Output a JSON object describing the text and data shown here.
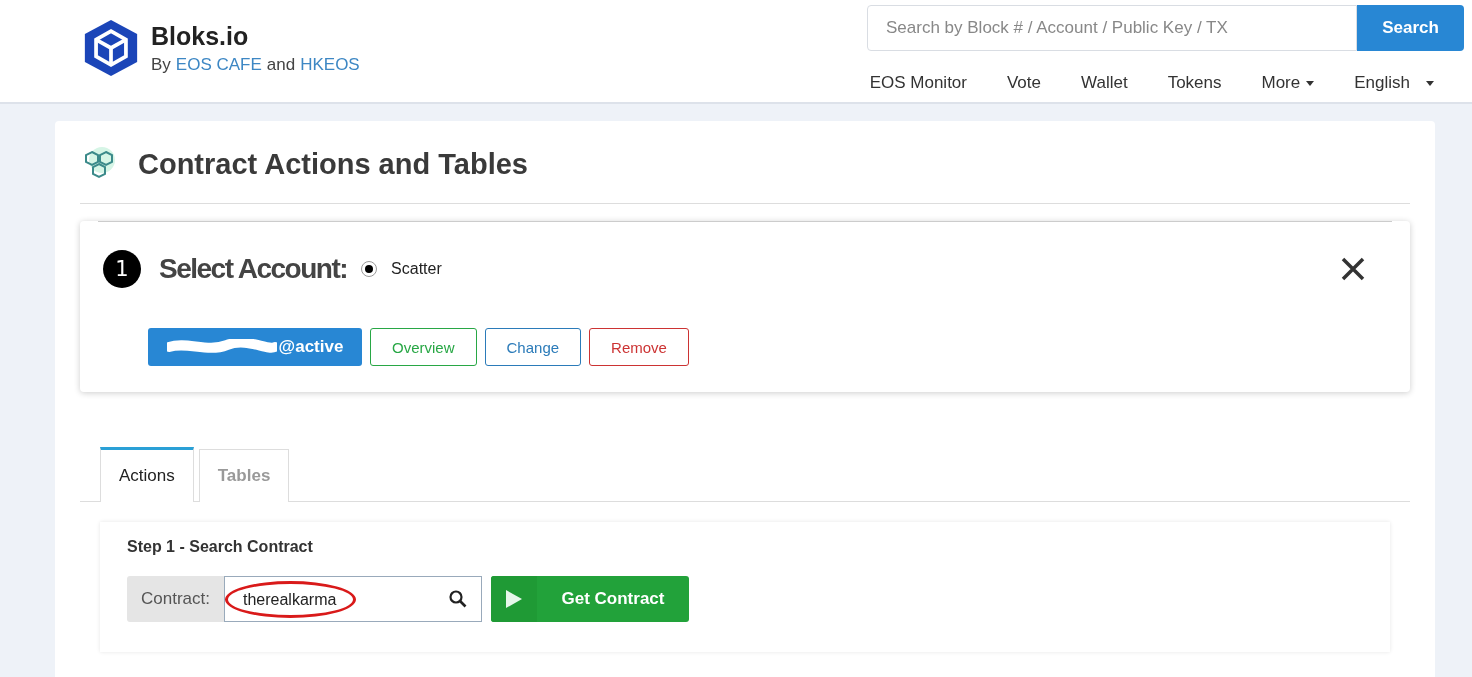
{
  "brand": {
    "name": "Bloks.io",
    "byline_prefix": "By",
    "link_1": "EOS CAFE",
    "byline_joiner": "and",
    "link_2": "HKEOS"
  },
  "search": {
    "placeholder": "Search by Block # / Account / Public Key / TX",
    "button": "Search"
  },
  "nav": [
    {
      "label": "EOS Monitor",
      "dropdown": false
    },
    {
      "label": "Vote",
      "dropdown": false
    },
    {
      "label": "Wallet",
      "dropdown": false
    },
    {
      "label": "Tokens",
      "dropdown": false
    },
    {
      "label": "More",
      "dropdown": true
    },
    {
      "label": "English",
      "dropdown": true
    }
  ],
  "page_title": "Contract Actions and Tables",
  "account_panel": {
    "step": "1",
    "title": "Select Account:",
    "radio": {
      "label": "Scatter",
      "selected": true
    },
    "account_button": "@active",
    "buttons": [
      {
        "label": "Overview",
        "color": "#28a745"
      },
      {
        "label": "Change",
        "color": "#2b7bb9"
      },
      {
        "label": "Remove",
        "color": "#cc3333"
      }
    ]
  },
  "tabs": [
    {
      "label": "Actions",
      "selected": true
    },
    {
      "label": "Tables",
      "selected": false
    }
  ],
  "step_1": {
    "title": "Step 1 - Search Contract",
    "field_label": "Contract:",
    "value": "therealkarma",
    "button": "Get Contract"
  }
}
